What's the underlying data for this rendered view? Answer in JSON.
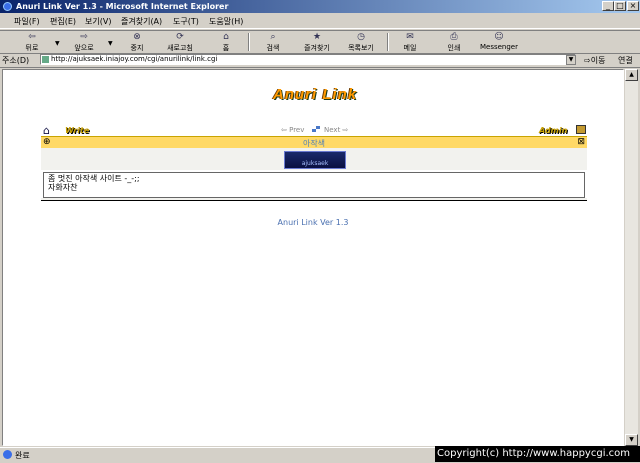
{
  "window": {
    "title": "Anuri Link Ver 1.3 - Microsoft Internet Explorer",
    "controls": [
      "_",
      "□",
      "×"
    ]
  },
  "menu": [
    "파일(F)",
    "편집(E)",
    "보기(V)",
    "즐겨찾기(A)",
    "도구(T)",
    "도움말(H)"
  ],
  "toolbar": {
    "back": "뒤로",
    "forward": "앞으로",
    "stop": "중지",
    "refresh": "새로고침",
    "home": "홈",
    "search": "검색",
    "favorites": "즐겨찾기",
    "history": "목록보기",
    "mail": "메일",
    "print": "인쇄",
    "messenger": "Messenger"
  },
  "address": {
    "label": "주소(D)",
    "url": "http://ajuksaek.iniajoy.com/cgi/anurilink/link.cgi",
    "go": "이동",
    "links": "연결"
  },
  "page": {
    "logo": "Anuri Link",
    "write": "Write",
    "prev": "Prev",
    "next": "Next",
    "admin": "Admin",
    "category": "아작색",
    "banner_text": "ajuksaek",
    "description_line1": "좀 멋진 아작색 사이트 -_-;;",
    "description_line2": "자화자찬",
    "footer": "Anuri Link Ver 1.3"
  },
  "status": {
    "text": "완료",
    "copyright": "Copyright(c) http://www.happycgi.com"
  }
}
